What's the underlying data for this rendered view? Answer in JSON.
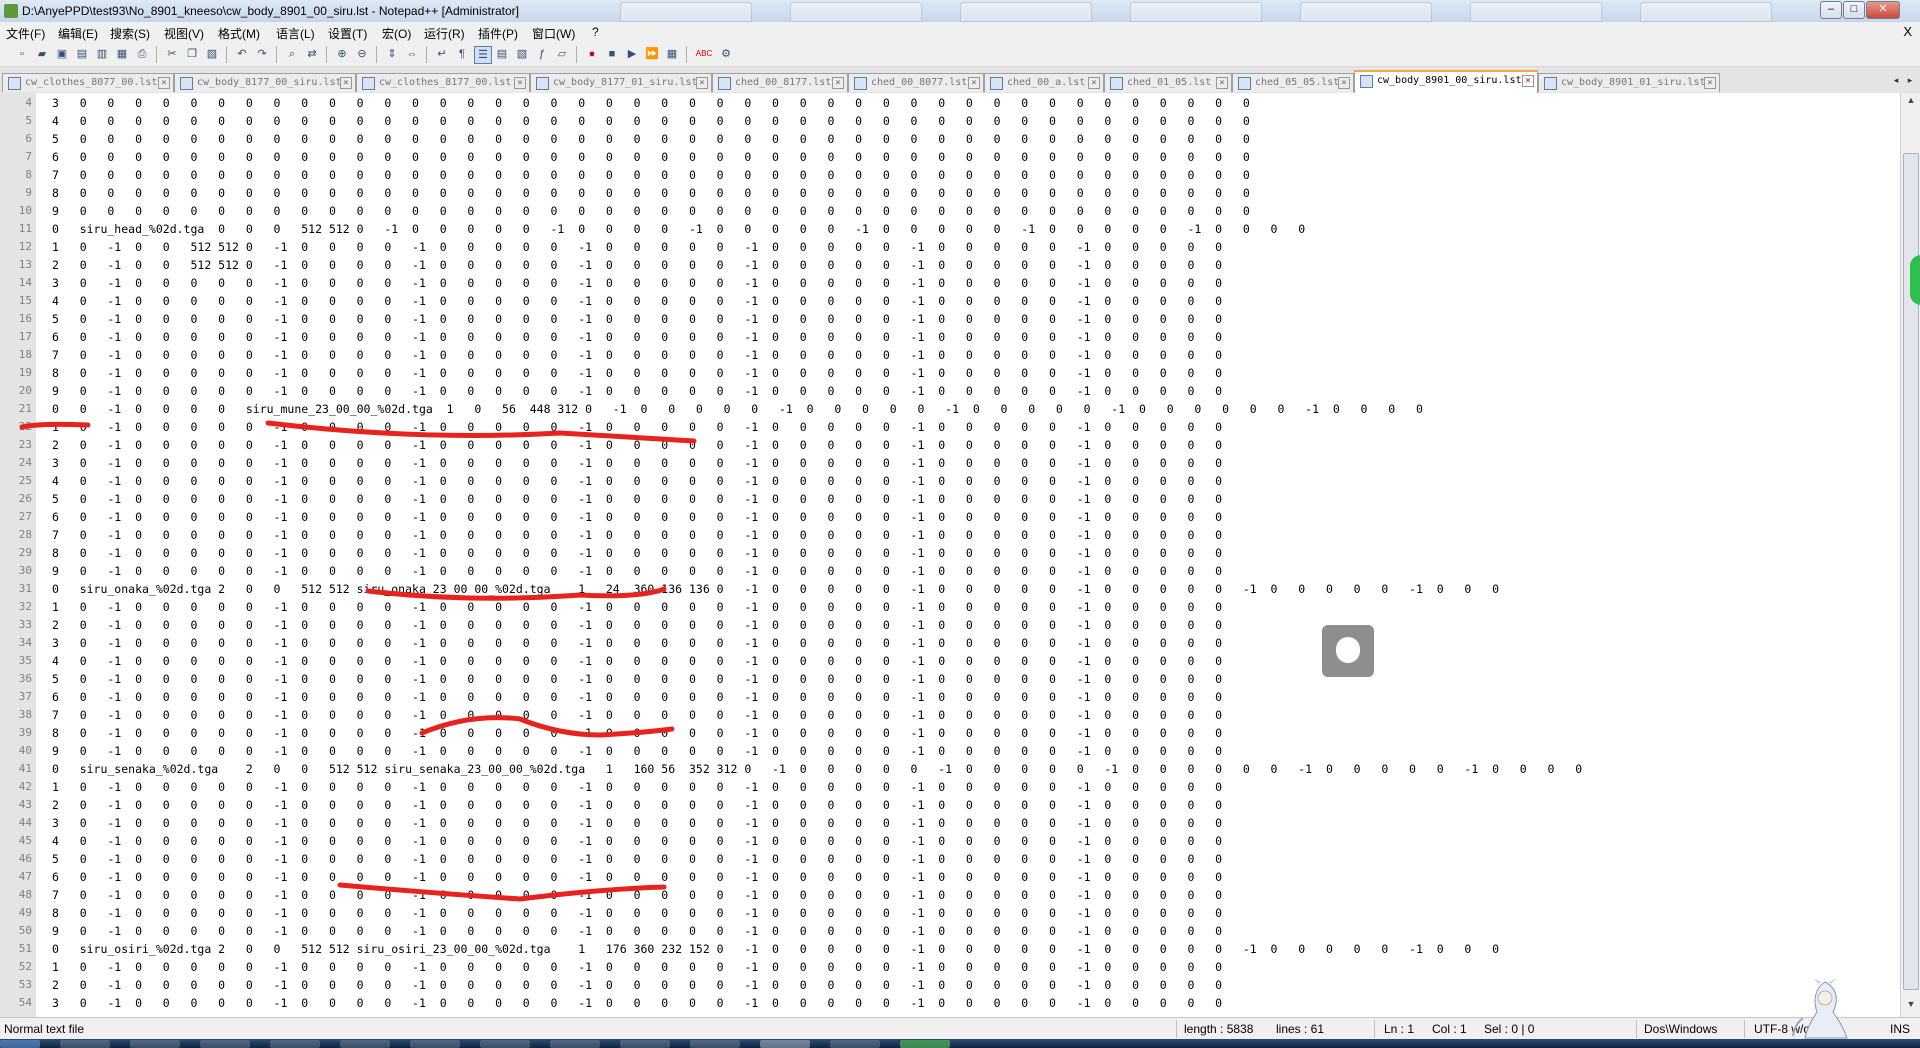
{
  "window": {
    "title": "D:\\AnyePPD\\test93\\No_8901_kneeso\\cw_body_8901_00_siru.lst - Notepad++ [Administrator]",
    "controls": [
      "–",
      "□",
      "✕"
    ]
  },
  "menubar": {
    "items": [
      "文件(F)",
      "编辑(E)",
      "搜索(S)",
      "视图(V)",
      "格式(M)",
      "语言(L)",
      "设置(T)",
      "宏(O)",
      "运行(R)",
      "插件(P)",
      "窗口(W)",
      "?"
    ],
    "close": "X"
  },
  "toolbar": {
    "icons": [
      "new-file-icon",
      "open-file-icon",
      "save-icon",
      "save-all-icon",
      "close-file-icon",
      "close-all-icon",
      "print-icon",
      "cut-icon",
      "copy-icon",
      "paste-icon",
      "undo-icon",
      "redo-icon",
      "find-icon",
      "replace-icon",
      "zoom-in-icon",
      "zoom-out-icon",
      "sync-v-icon",
      "sync-h-icon",
      "word-wrap-icon",
      "all-chars-icon",
      "indent-guide-icon",
      "udl-icon",
      "doc-map-icon",
      "function-list-icon",
      "folder-workspace-icon",
      "record-macro-icon",
      "stop-record-icon",
      "play-macro-icon",
      "play-multiple-icon",
      "save-macro-icon",
      "spellcheck-icon",
      "plugin-icon"
    ]
  },
  "tabs": [
    {
      "label": "cw_clothes_8077_00.lst",
      "active": false
    },
    {
      "label": "cw_body_8177_00_siru.lst",
      "active": false
    },
    {
      "label": "cw_clothes_8177_00.lst",
      "active": false
    },
    {
      "label": "cw_body_8177_01_siru.lst",
      "active": false
    },
    {
      "label": "ched_00_8177.lst",
      "active": false
    },
    {
      "label": "ched_00_8077.lst",
      "active": false
    },
    {
      "label": "ched_00_a.lst",
      "active": false
    },
    {
      "label": "ched_01_05.lst",
      "active": false
    },
    {
      "label": "ched_05_05.lst",
      "active": false
    },
    {
      "label": "cw_body_8901_00_siru.lst",
      "active": true
    },
    {
      "label": "cw_body_8901_01_siru.lst",
      "active": false
    }
  ],
  "editor": {
    "lines": [
      {
        "n": "4",
        "text": "3   0   0   0   0   0   0   0   0   0   0   0   0   0   0   0   0   0   0   0   0   0   0   0   0   0   0   0   0   0   0   0   0   0   0   0   0   0   0   0   0   0   0   0"
      },
      {
        "n": "5",
        "text": "4   0   0   0   0   0   0   0   0   0   0   0   0   0   0   0   0   0   0   0   0   0   0   0   0   0   0   0   0   0   0   0   0   0   0   0   0   0   0   0   0   0   0   0"
      },
      {
        "n": "6",
        "text": "5   0   0   0   0   0   0   0   0   0   0   0   0   0   0   0   0   0   0   0   0   0   0   0   0   0   0   0   0   0   0   0   0   0   0   0   0   0   0   0   0   0   0   0"
      },
      {
        "n": "7",
        "text": "6   0   0   0   0   0   0   0   0   0   0   0   0   0   0   0   0   0   0   0   0   0   0   0   0   0   0   0   0   0   0   0   0   0   0   0   0   0   0   0   0   0   0   0"
      },
      {
        "n": "8",
        "text": "7   0   0   0   0   0   0   0   0   0   0   0   0   0   0   0   0   0   0   0   0   0   0   0   0   0   0   0   0   0   0   0   0   0   0   0   0   0   0   0   0   0   0   0"
      },
      {
        "n": "9",
        "text": "8   0   0   0   0   0   0   0   0   0   0   0   0   0   0   0   0   0   0   0   0   0   0   0   0   0   0   0   0   0   0   0   0   0   0   0   0   0   0   0   0   0   0   0"
      },
      {
        "n": "10",
        "text": "9   0   0   0   0   0   0   0   0   0   0   0   0   0   0   0   0   0   0   0   0   0   0   0   0   0   0   0   0   0   0   0   0   0   0   0   0   0   0   0   0   0   0   0"
      },
      {
        "n": "11",
        "text": "0   siru_head_%02d.tga  0   0   0   512 512 0   -1  0   0   0   0   0   -1  0   0   0   0   -1  0   0   0   0   0   -1  0   0   0   0   0   -1  0   0   0   0   0   -1  0   0   0   0"
      },
      {
        "n": "12",
        "text": "1   0   -1  0   0   512 512 0   -1  0   0   0   0   -1  0   0   0   0   0   -1  0   0   0   0   0   -1  0   0   0   0   0   -1  0   0   0   0   0   -1  0   0   0   0   0"
      },
      {
        "n": "13",
        "text": "2   0   -1  0   0   512 512 0   -1  0   0   0   0   -1  0   0   0   0   0   -1  0   0   0   0   0   -1  0   0   0   0   0   -1  0   0   0   0   0   -1  0   0   0   0   0"
      },
      {
        "n": "14",
        "text": "3   0   -1  0   0   0   0   0   -1  0   0   0   0   -1  0   0   0   0   0   -1  0   0   0   0   0   -1  0   0   0   0   0   -1  0   0   0   0   0   -1  0   0   0   0   0"
      },
      {
        "n": "15",
        "text": "4   0   -1  0   0   0   0   0   -1  0   0   0   0   -1  0   0   0   0   0   -1  0   0   0   0   0   -1  0   0   0   0   0   -1  0   0   0   0   0   -1  0   0   0   0   0"
      },
      {
        "n": "16",
        "text": "5   0   -1  0   0   0   0   0   -1  0   0   0   0   -1  0   0   0   0   0   -1  0   0   0   0   0   -1  0   0   0   0   0   -1  0   0   0   0   0   -1  0   0   0   0   0"
      },
      {
        "n": "17",
        "text": "6   0   -1  0   0   0   0   0   -1  0   0   0   0   -1  0   0   0   0   0   -1  0   0   0   0   0   -1  0   0   0   0   0   -1  0   0   0   0   0   -1  0   0   0   0   0"
      },
      {
        "n": "18",
        "text": "7   0   -1  0   0   0   0   0   -1  0   0   0   0   -1  0   0   0   0   0   -1  0   0   0   0   0   -1  0   0   0   0   0   -1  0   0   0   0   0   -1  0   0   0   0   0"
      },
      {
        "n": "19",
        "text": "8   0   -1  0   0   0   0   0   -1  0   0   0   0   -1  0   0   0   0   0   -1  0   0   0   0   0   -1  0   0   0   0   0   -1  0   0   0   0   0   -1  0   0   0   0   0"
      },
      {
        "n": "20",
        "text": "9   0   -1  0   0   0   0   0   -1  0   0   0   0   -1  0   0   0   0   0   -1  0   0   0   0   0   -1  0   0   0   0   0   -1  0   0   0   0   0   -1  0   0   0   0   0"
      },
      {
        "n": "21",
        "text": "0   0   -1  0   0   0   0   siru_mune_23_00_00_%02d.tga  1   0   56  448 312 0   -1  0   0   0   0   0   -1  0   0   0   0   0   -1  0   0   0   0   0   -1  0   0   0   0   0   0   -1  0   0   0   0"
      },
      {
        "n": "22",
        "text": "1   0   -1  0   0   0   0   0   -1  0   0   0   0   -1  0   0   0   0   0   -1  0   0   0   0   0   -1  0   0   0   0   0   -1  0   0   0   0   0   -1  0   0   0   0   0"
      },
      {
        "n": "23",
        "text": "2   0   -1  0   0   0   0   0   -1  0   0   0   0   -1  0   0   0   0   0   -1  0   0   0   0   0   -1  0   0   0   0   0   -1  0   0   0   0   0   -1  0   0   0   0   0"
      },
      {
        "n": "24",
        "text": "3   0   -1  0   0   0   0   0   -1  0   0   0   0   -1  0   0   0   0   0   -1  0   0   0   0   0   -1  0   0   0   0   0   -1  0   0   0   0   0   -1  0   0   0   0   0"
      },
      {
        "n": "25",
        "text": "4   0   -1  0   0   0   0   0   -1  0   0   0   0   -1  0   0   0   0   0   -1  0   0   0   0   0   -1  0   0   0   0   0   -1  0   0   0   0   0   -1  0   0   0   0   0"
      },
      {
        "n": "26",
        "text": "5   0   -1  0   0   0   0   0   -1  0   0   0   0   -1  0   0   0   0   0   -1  0   0   0   0   0   -1  0   0   0   0   0   -1  0   0   0   0   0   -1  0   0   0   0   0"
      },
      {
        "n": "27",
        "text": "6   0   -1  0   0   0   0   0   -1  0   0   0   0   -1  0   0   0   0   0   -1  0   0   0   0   0   -1  0   0   0   0   0   -1  0   0   0   0   0   -1  0   0   0   0   0"
      },
      {
        "n": "28",
        "text": "7   0   -1  0   0   0   0   0   -1  0   0   0   0   -1  0   0   0   0   0   -1  0   0   0   0   0   -1  0   0   0   0   0   -1  0   0   0   0   0   -1  0   0   0   0   0"
      },
      {
        "n": "29",
        "text": "8   0   -1  0   0   0   0   0   -1  0   0   0   0   -1  0   0   0   0   0   -1  0   0   0   0   0   -1  0   0   0   0   0   -1  0   0   0   0   0   -1  0   0   0   0   0"
      },
      {
        "n": "30",
        "text": "9   0   -1  0   0   0   0   0   -1  0   0   0   0   -1  0   0   0   0   0   -1  0   0   0   0   0   -1  0   0   0   0   0   -1  0   0   0   0   0   -1  0   0   0   0   0"
      },
      {
        "n": "31",
        "text": "0   siru_onaka_%02d.tga 2   0   0   512 512 siru_onaka_23_00_00_%02d.tga    1   24  360 136 136 0   -1  0   0   0   0   0   -1  0   0   0   0   0   -1  0   0   0   0   0   -1  0   0   0   0   0   -1  0   0   0"
      },
      {
        "n": "32",
        "text": "1   0   -1  0   0   0   0   0   -1  0   0   0   0   -1  0   0   0   0   0   -1  0   0   0   0   0   -1  0   0   0   0   0   -1  0   0   0   0   0   -1  0   0   0   0   0"
      },
      {
        "n": "33",
        "text": "2   0   -1  0   0   0   0   0   -1  0   0   0   0   -1  0   0   0   0   0   -1  0   0   0   0   0   -1  0   0   0   0   0   -1  0   0   0   0   0   -1  0   0   0   0   0"
      },
      {
        "n": "34",
        "text": "3   0   -1  0   0   0   0   0   -1  0   0   0   0   -1  0   0   0   0   0   -1  0   0   0   0   0   -1  0   0   0   0   0   -1  0   0   0   0   0   -1  0   0   0   0   0"
      },
      {
        "n": "35",
        "text": "4   0   -1  0   0   0   0   0   -1  0   0   0   0   -1  0   0   0   0   0   -1  0   0   0   0   0   -1  0   0   0   0   0   -1  0   0   0   0   0   -1  0   0   0   0   0"
      },
      {
        "n": "36",
        "text": "5   0   -1  0   0   0   0   0   -1  0   0   0   0   -1  0   0   0   0   0   -1  0   0   0   0   0   -1  0   0   0   0   0   -1  0   0   0   0   0   -1  0   0   0   0   0"
      },
      {
        "n": "37",
        "text": "6   0   -1  0   0   0   0   0   -1  0   0   0   0   -1  0   0   0   0   0   -1  0   0   0   0   0   -1  0   0   0   0   0   -1  0   0   0   0   0   -1  0   0   0   0   0"
      },
      {
        "n": "38",
        "text": "7   0   -1  0   0   0   0   0   -1  0   0   0   0   -1  0   0   0   0   0   -1  0   0   0   0   0   -1  0   0   0   0   0   -1  0   0   0   0   0   -1  0   0   0   0   0"
      },
      {
        "n": "39",
        "text": "8   0   -1  0   0   0   0   0   -1  0   0   0   0   -1  0   0   0   0   0   -1  0   0   0   0   0   -1  0   0   0   0   0   -1  0   0   0   0   0   -1  0   0   0   0   0"
      },
      {
        "n": "40",
        "text": "9   0   -1  0   0   0   0   0   -1  0   0   0   0   -1  0   0   0   0   0   -1  0   0   0   0   0   -1  0   0   0   0   0   -1  0   0   0   0   0   -1  0   0   0   0   0"
      },
      {
        "n": "41",
        "text": "0   siru_senaka_%02d.tga    2   0   0   512 512 siru_senaka_23_00_00_%02d.tga   1   160 56  352 312 0   -1  0   0   0   0   0   -1  0   0   0   0   0   -1  0   0   0   0   0   0   -1  0   0   0   0   0   -1  0   0   0   0"
      },
      {
        "n": "42",
        "text": "1   0   -1  0   0   0   0   0   -1  0   0   0   0   -1  0   0   0   0   0   -1  0   0   0   0   0   -1  0   0   0   0   0   -1  0   0   0   0   0   -1  0   0   0   0   0"
      },
      {
        "n": "43",
        "text": "2   0   -1  0   0   0   0   0   -1  0   0   0   0   -1  0   0   0   0   0   -1  0   0   0   0   0   -1  0   0   0   0   0   -1  0   0   0   0   0   -1  0   0   0   0   0"
      },
      {
        "n": "44",
        "text": "3   0   -1  0   0   0   0   0   -1  0   0   0   0   -1  0   0   0   0   0   -1  0   0   0   0   0   -1  0   0   0   0   0   -1  0   0   0   0   0   -1  0   0   0   0   0"
      },
      {
        "n": "45",
        "text": "4   0   -1  0   0   0   0   0   -1  0   0   0   0   -1  0   0   0   0   0   -1  0   0   0   0   0   -1  0   0   0   0   0   -1  0   0   0   0   0   -1  0   0   0   0   0"
      },
      {
        "n": "46",
        "text": "5   0   -1  0   0   0   0   0   -1  0   0   0   0   -1  0   0   0   0   0   -1  0   0   0   0   0   -1  0   0   0   0   0   -1  0   0   0   0   0   -1  0   0   0   0   0"
      },
      {
        "n": "47",
        "text": "6   0   -1  0   0   0   0   0   -1  0   0   0   0   -1  0   0   0   0   0   -1  0   0   0   0   0   -1  0   0   0   0   0   -1  0   0   0   0   0   -1  0   0   0   0   0"
      },
      {
        "n": "48",
        "text": "7   0   -1  0   0   0   0   0   -1  0   0   0   0   -1  0   0   0   0   0   -1  0   0   0   0   0   -1  0   0   0   0   0   -1  0   0   0   0   0   -1  0   0   0   0   0"
      },
      {
        "n": "49",
        "text": "8   0   -1  0   0   0   0   0   -1  0   0   0   0   -1  0   0   0   0   0   -1  0   0   0   0   0   -1  0   0   0   0   0   -1  0   0   0   0   0   -1  0   0   0   0   0"
      },
      {
        "n": "50",
        "text": "9   0   -1  0   0   0   0   0   -1  0   0   0   0   -1  0   0   0   0   0   -1  0   0   0   0   0   -1  0   0   0   0   0   -1  0   0   0   0   0   -1  0   0   0   0   0"
      },
      {
        "n": "51",
        "text": "0   siru_osiri_%02d.tga 2   0   0   512 512 siru_osiri_23_00_00_%02d.tga    1   176 360 232 152 0   -1  0   0   0   0   0   -1  0   0   0   0   0   -1  0   0   0   0   0   -1  0   0   0   0   0   -1  0   0   0"
      },
      {
        "n": "52",
        "text": "1   0   -1  0   0   0   0   0   -1  0   0   0   0   -1  0   0   0   0   0   -1  0   0   0   0   0   -1  0   0   0   0   0   -1  0   0   0   0   0   -1  0   0   0   0   0"
      },
      {
        "n": "53",
        "text": "2   0   -1  0   0   0   0   0   -1  0   0   0   0   -1  0   0   0   0   0   -1  0   0   0   0   0   -1  0   0   0   0   0   -1  0   0   0   0   0   -1  0   0   0   0   0"
      },
      {
        "n": "54",
        "text": "3   0   -1  0   0   0   0   0   -1  0   0   0   0   -1  0   0   0   0   0   -1  0   0   0   0   0   -1  0   0   0   0   0   -1  0   0   0   0   0   -1  0   0   0   0   0"
      }
    ]
  },
  "status": {
    "file_type": "Normal text file",
    "length": "length : 5838",
    "lines": "lines : 61",
    "ln": "Ln : 1",
    "col": "Col : 1",
    "sel": "Sel : 0 | 0",
    "eol": "Dos\\Windows",
    "encoding": "UTF-8 w/o BOM",
    "mode": "INS"
  },
  "colors": {
    "annotation_red": "#e8231f",
    "active_tab_accent": "#f5a742",
    "gutter_bg": "#e4e4e4"
  }
}
